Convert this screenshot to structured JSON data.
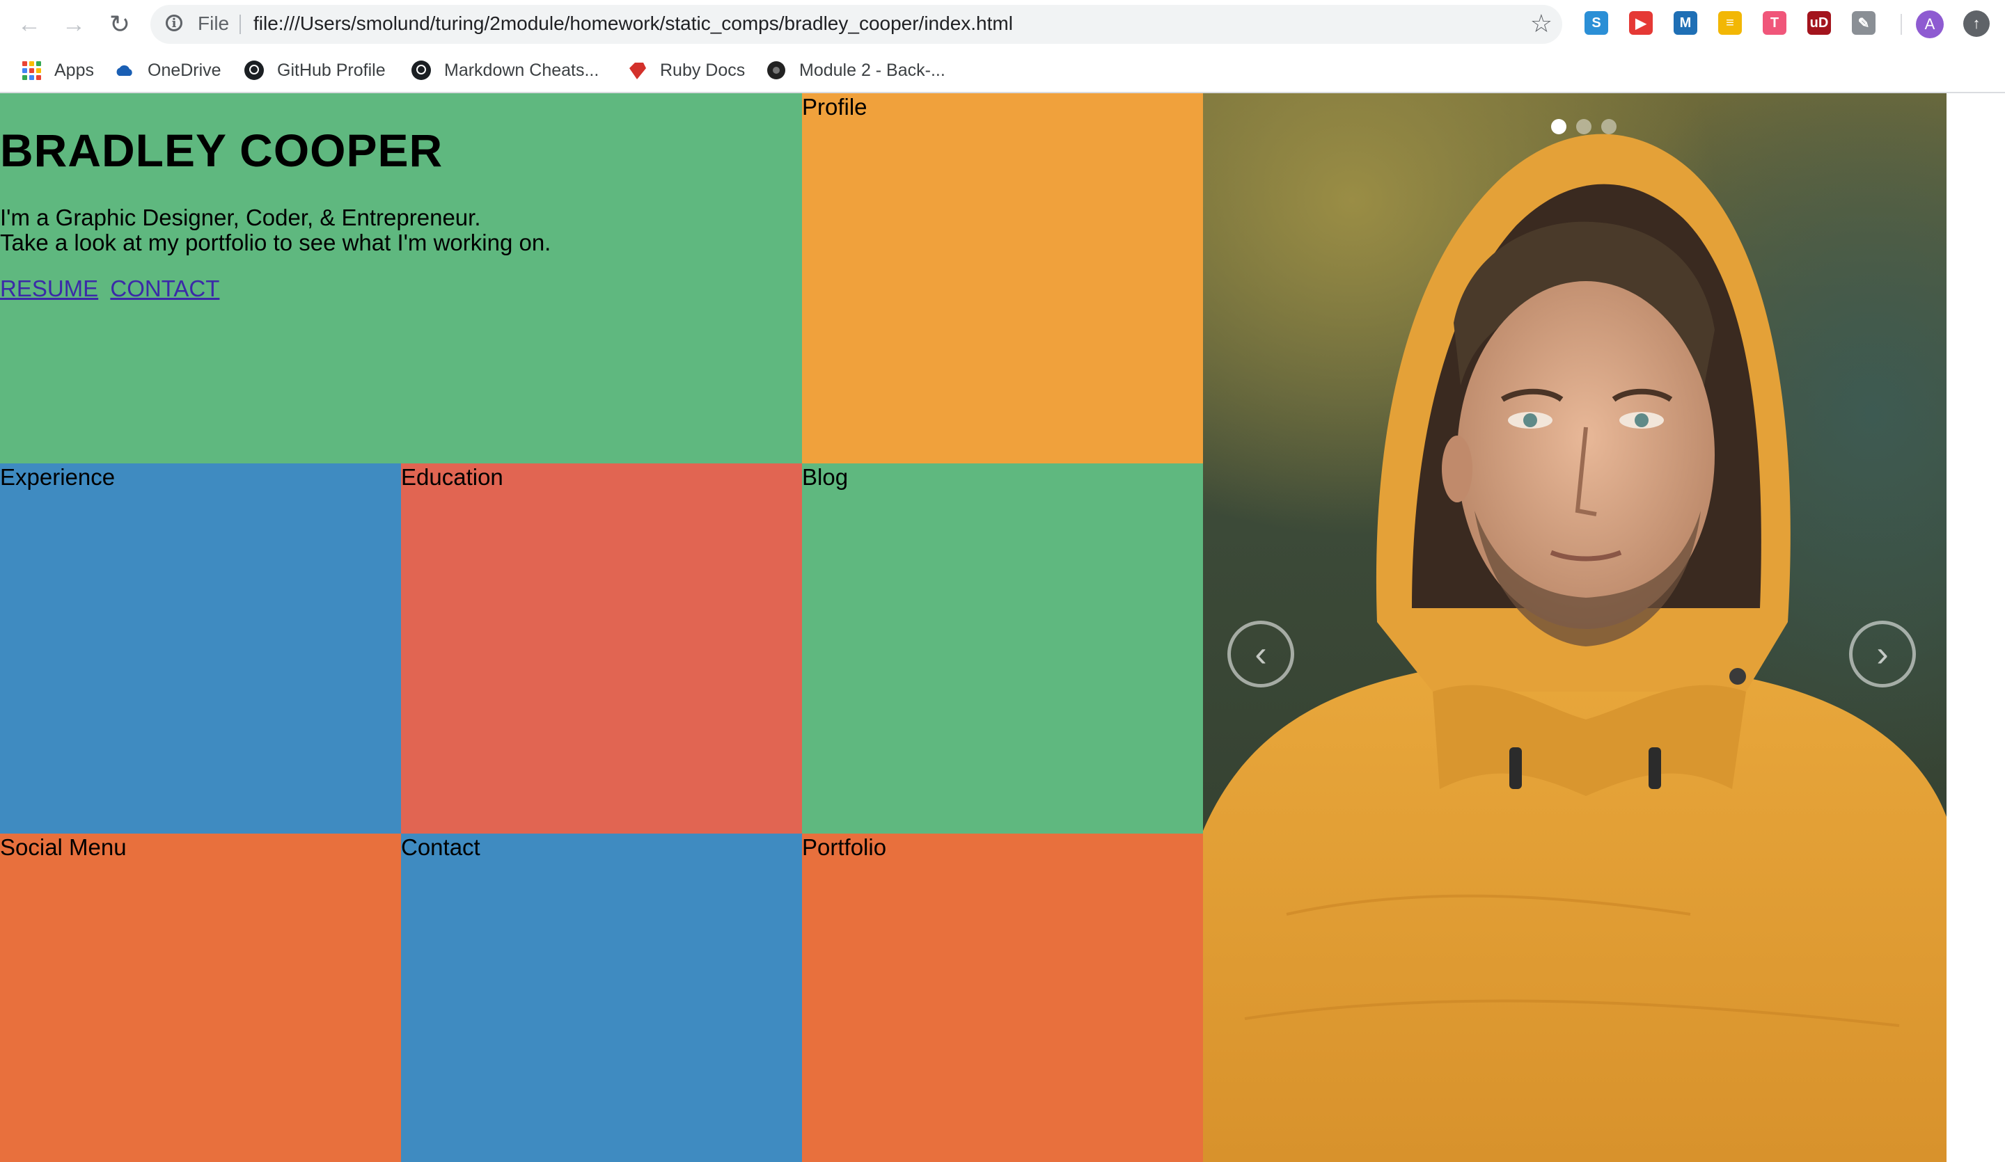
{
  "browser": {
    "scheme_label": "File",
    "url": "file:///Users/smolund/turing/2module/homework/static_comps/bradley_cooper/index.html",
    "avatar_letter": "A",
    "extensions": [
      {
        "name": "s-extension-icon",
        "glyph": "S",
        "color": "#2b8fd6"
      },
      {
        "name": "youtube-extension-icon",
        "glyph": "▶",
        "color": "#e53935"
      },
      {
        "name": "m-extension-icon",
        "glyph": "M",
        "color": "#1f6fb5"
      },
      {
        "name": "notes-extension-icon",
        "glyph": "≡",
        "color": "#f2b705"
      },
      {
        "name": "t-extension-icon",
        "glyph": "T",
        "color": "#f0567a"
      },
      {
        "name": "ublock-extension-icon",
        "glyph": "uD",
        "color": "#a3141d"
      },
      {
        "name": "eyedropper-extension-icon",
        "glyph": "✎",
        "color": "#8a8f95"
      }
    ]
  },
  "bookmarks": [
    {
      "label": "Apps",
      "icon": "apps-grid-icon"
    },
    {
      "label": "OneDrive",
      "icon": "onedrive-cloud-icon"
    },
    {
      "label": "GitHub Profile",
      "icon": "github-icon"
    },
    {
      "label": "Markdown Cheats...",
      "icon": "github-icon"
    },
    {
      "label": "Ruby Docs",
      "icon": "ruby-icon"
    },
    {
      "label": "Module 2 - Back-...",
      "icon": "turing-icon"
    }
  ],
  "hero": {
    "title": "BRADLEY COOPER",
    "line1": "I'm a Graphic Designer, Coder, & Entrepreneur.",
    "line2": "Take a look at my portfolio to see what I'm working on.",
    "resume_link": "RESUME",
    "contact_link": "CONTACT"
  },
  "tiles": {
    "profile": "Profile",
    "experience": "Experience",
    "education": "Education",
    "blog": "Blog",
    "social": "Social Menu",
    "contact": "Contact",
    "portfolio": "Portfolio"
  },
  "carousel": {
    "prev_glyph": "‹",
    "next_glyph": "›",
    "slides": 3,
    "active_slide": 1
  },
  "colors": {
    "green": "#5fb87f",
    "orange_light": "#f0a13c",
    "blue": "#3f8bc1",
    "red": "#e16552",
    "orange": "#e8703d",
    "link": "#3b2aa8",
    "jacket": "#e6a43a"
  }
}
